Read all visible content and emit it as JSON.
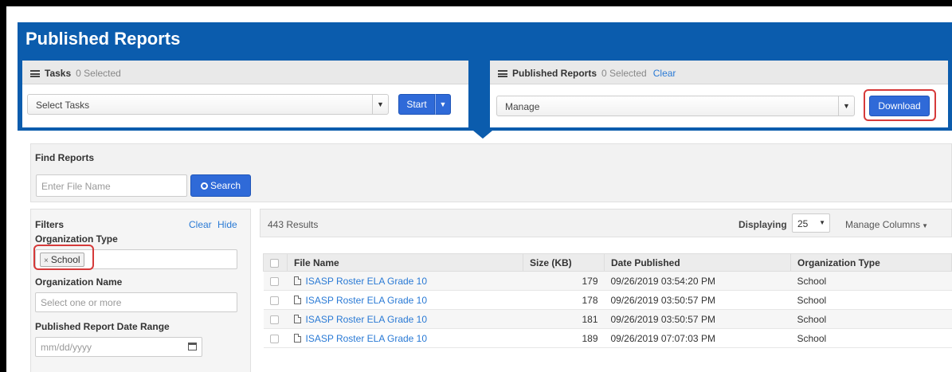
{
  "page": {
    "title": "Published Reports"
  },
  "tasks_panel": {
    "title": "Tasks",
    "selected": "0 Selected",
    "select_value": "Select Tasks",
    "start_label": "Start"
  },
  "reports_panel": {
    "title": "Published Reports",
    "selected": "0 Selected",
    "clear_label": "Clear",
    "select_value": "Manage",
    "download_label": "Download"
  },
  "find": {
    "title": "Find Reports",
    "placeholder": "Enter File Name",
    "search_label": "Search"
  },
  "filters": {
    "title": "Filters",
    "clear_label": "Clear",
    "hide_label": "Hide",
    "org_type_label": "Organization Type",
    "org_type_chip": "School",
    "org_name_label": "Organization Name",
    "org_name_placeholder": "Select one or more",
    "date_label": "Published Report Date Range",
    "date_placeholder": "mm/dd/yyyy"
  },
  "results": {
    "count": "443 Results",
    "displaying_label": "Displaying",
    "per_page": "25",
    "manage_columns": "Manage Columns",
    "columns": [
      "File Name",
      "Size (KB)",
      "Date Published",
      "Organization Type"
    ],
    "rows": [
      {
        "file": "ISASP Roster ELA Grade 10",
        "size": "179",
        "date": "09/26/2019 03:54:20 PM",
        "org": "School"
      },
      {
        "file": "ISASP Roster ELA Grade 10",
        "size": "178",
        "date": "09/26/2019 03:50:57 PM",
        "org": "School"
      },
      {
        "file": "ISASP Roster ELA Grade 10",
        "size": "181",
        "date": "09/26/2019 03:50:57 PM",
        "org": "School"
      },
      {
        "file": "ISASP Roster ELA Grade 10",
        "size": "189",
        "date": "09/26/2019 07:07:03 PM",
        "org": "School"
      }
    ]
  },
  "colors": {
    "brand": "#0b5cad",
    "button": "#2f6ad8",
    "link": "#2a7ad5",
    "highlight": "#d63a3a"
  }
}
